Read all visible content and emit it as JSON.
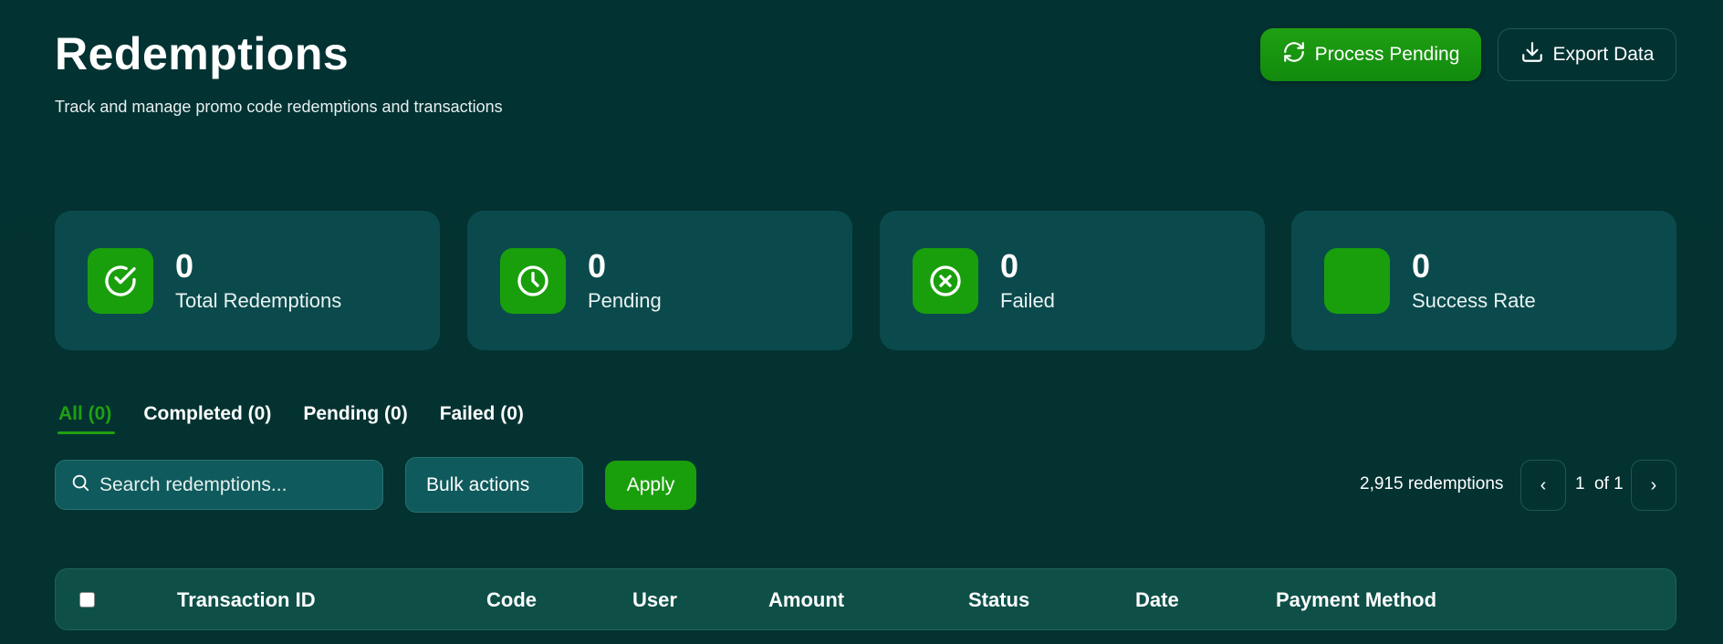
{
  "header": {
    "title": "Redemptions",
    "subtitle": "Track and manage promo code redemptions and transactions",
    "process_label": "Process Pending",
    "export_label": "Export Data"
  },
  "stats": [
    {
      "value": "0",
      "label": "Total Redemptions",
      "icon": "check-circle-icon"
    },
    {
      "value": "0",
      "label": "Pending",
      "icon": "clock-icon"
    },
    {
      "value": "0",
      "label": "Failed",
      "icon": "x-circle-icon"
    },
    {
      "value": "0",
      "label": "Success Rate",
      "icon": "blank-icon"
    }
  ],
  "tabs": [
    {
      "label": "All (0)",
      "active": true
    },
    {
      "label": "Completed (0)",
      "active": false
    },
    {
      "label": "Pending (0)",
      "active": false
    },
    {
      "label": "Failed (0)",
      "active": false
    }
  ],
  "toolbar": {
    "search_placeholder": "Search redemptions...",
    "bulk_label": "Bulk actions",
    "apply_label": "Apply",
    "count_text": "2,915 redemptions"
  },
  "pagination": {
    "prev": "‹",
    "page": "1",
    "of_text": "of 1",
    "next": "›"
  },
  "table": {
    "columns": [
      "Transaction ID",
      "Code",
      "User",
      "Amount",
      "Status",
      "Date",
      "Payment Method"
    ]
  },
  "colors": {
    "background": "#033232",
    "card": "#0b4a4c",
    "accent": "#1a9f0c"
  }
}
